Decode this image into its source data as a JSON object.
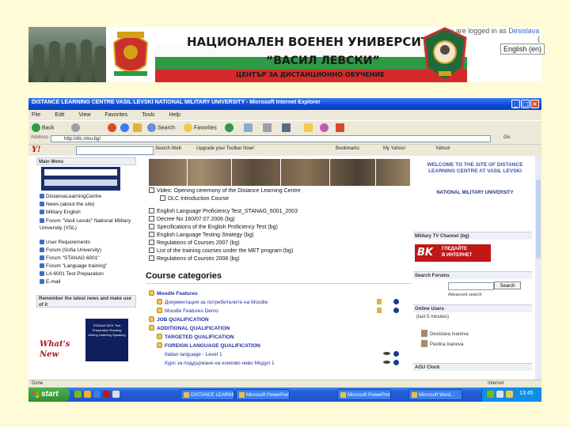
{
  "banner": {
    "title_line1": "НАЦИОНАЛЕН ВОЕНЕН УНИВЕРСИТЕТ",
    "title_line2": "“ВАСИЛ ЛЕВСКИ”",
    "title_line3": "ЦЕНТЪР ЗА ДИСТАНЦИОННО ОБУЧЕНИЕ",
    "logged_in_prefix": "You are logged in as",
    "logged_in_user": "Desislava",
    "paren": "(",
    "language_selected": "English (en)"
  },
  "browser": {
    "window_title": "DISTANCE LEARNING CENTRE VASIL LEVSKI NATIONAL MILITARY UNIVERSITY - Microsoft Internet Explorer",
    "menu": [
      "File",
      "Edit",
      "View",
      "Favorites",
      "Tools",
      "Help"
    ],
    "toolbar": {
      "back": "Back",
      "search": "Search",
      "favorites": "Favorites"
    },
    "address_label": "Address",
    "address_value": "http://dlc.nmu.bg/",
    "go_label": "Go",
    "yahoo": {
      "logo": "Y!",
      "search_web": "Search Web",
      "upgrade": "Upgrade your Toolbar Now!",
      "bookmarks": "Bookmarks",
      "my_yahoo": "My Yahoo!",
      "yahoo": "Yahoo!"
    }
  },
  "left": {
    "main_menu_title": "Main Menu",
    "menu_items": [
      "DistanceLearningCentre",
      "News (about the site)",
      "Military English",
      "Forum \"Vasil Levski\" National Military University (VSL)",
      "User Requirements",
      "Forum (Sofia University)",
      "Forum \"STANAG 6001\"",
      "Forum \"Language training\"",
      "LA 6001 Test Preparation",
      "E-mail"
    ],
    "whats_new_title": "Remember the latest news and make use of it",
    "poster_text": "STANAG 6001 Test Preparation Reading Writing Listening Speaking",
    "whats_new": "What's New"
  },
  "center": {
    "links": [
      "Video: Opening ceremony of the Distance Learning Centre",
      "DLC Introduction Course",
      "English Language Proficiency Test_STANAG_6001_2003",
      "Decree No 160/07.07.2006 (bg)",
      "Specifications of the English Proficiency Test (bg)",
      "English Language Testing Strategy (bg)",
      "Regulations of Courses 2007 (bg)",
      "List of the training courses under the MET program (bg)",
      "Regulations of Courses 2008 (bg)"
    ],
    "course_categories_title": "Course categories",
    "categories": [
      {
        "label": "Moodle Features",
        "level": 1,
        "bold": true
      },
      {
        "label": "Документация за потребителите на Moodle",
        "level": 2,
        "bold": false
      },
      {
        "label": "Moodle Features Demo",
        "level": 2,
        "bold": false
      },
      {
        "label": "JOB QUALIFICATION",
        "level": 1,
        "bold": true
      },
      {
        "label": "ADDITIONAL QUALIFICATION",
        "level": 1,
        "bold": true
      },
      {
        "label": "TARGETED QUALIFICATION",
        "level": 2,
        "bold": true
      },
      {
        "label": "FOREIGN LANGUAGE QUALIFICATION",
        "level": 2,
        "bold": true
      },
      {
        "label": "Italian language - Level 1",
        "level": 3,
        "bold": false
      },
      {
        "label": "Курс за поддържане на езиково ниво Модул 1",
        "level": 3,
        "bold": false
      }
    ]
  },
  "right": {
    "welcome": "WELCOME TO THE SITE OF DISTANCE LEARNING CENTRE AT VASIL LEVSKI",
    "nmu": "NATIONAL MILITARY UNIVERSITY",
    "tv_header": "Military TV Channel (bg)",
    "tv_logo": "BK",
    "tv_text_line1": "ГЛЕДАЙТЕ",
    "tv_text_line2": "В ИНТЕРНЕТ",
    "search_header": "Search Forums",
    "search_button": "Search",
    "advanced_search": "Advanced search",
    "online_users_header": "Online Users",
    "online_users_note": "(last 5 minutes)",
    "users": [
      "Desislava Ivanova",
      "Pavlina Ivanova"
    ],
    "clock_header": "AGU Clock"
  },
  "status": {
    "text": "Done",
    "zone": "Internet"
  },
  "taskbar": {
    "start": "start",
    "tasks": [
      "DISTANCE LEARNING...",
      "Microsoft PowerPoint...",
      "Microsoft PowerPoint...",
      "Microsoft Word..."
    ],
    "clock": "13:45"
  },
  "colors": {
    "page_bg": "#fffbd6",
    "ie_blue": "#0a49d6",
    "link_blue": "#1f2ea8",
    "tv_red": "#c11717"
  }
}
